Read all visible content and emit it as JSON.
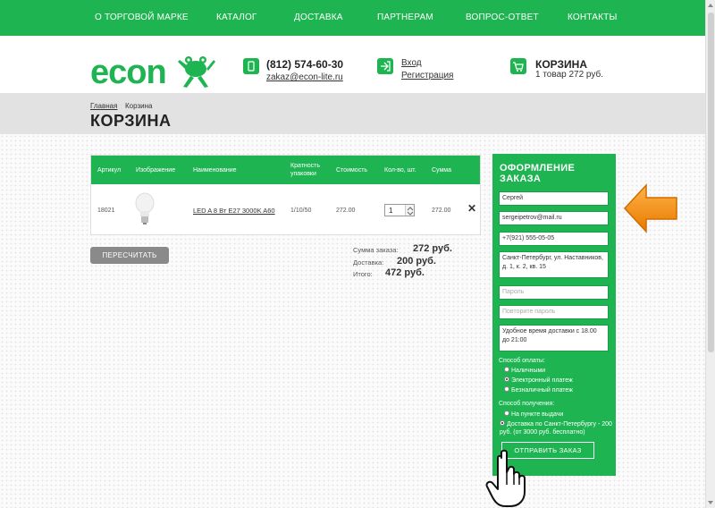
{
  "nav": {
    "items": [
      "О ТОРГОВОЙ МАРКЕ",
      "КАТАЛОГ",
      "ДОСТАВКА",
      "ПАРТНЕРАМ",
      "ВОПРОС-ОТВЕТ",
      "КОНТАКТЫ"
    ]
  },
  "brand": {
    "logo_text": "econ",
    "accent": "#1eb451"
  },
  "header": {
    "phone": "(812) 574-60-30",
    "email": "zakaz@econ-lite.ru",
    "login": "Вход",
    "register": "Регистрация",
    "cart_title": "КОРЗИНА",
    "cart_summary": "1 товар 272 руб."
  },
  "breadcrumb": {
    "home": "Главная",
    "current": "Корзина"
  },
  "page_title": "КОРЗИНА",
  "cart_table": {
    "headers": [
      "Артикул",
      "Изображение",
      "Наименование",
      "Кратность упаковки",
      "Стоимость",
      "Кол-во, шт.",
      "Сумма"
    ],
    "rows": [
      {
        "article": "18021",
        "image": "bulb-image",
        "name": "LED A 8 Вт E27 3000K A60",
        "pack": "1/10/50",
        "price": "272.00",
        "qty": "1",
        "sum": "272.00"
      }
    ]
  },
  "recalc_label": "ПЕРЕСЧИТАТЬ",
  "summary": {
    "subtotal_label": "Сумма заказа:",
    "subtotal": "272 руб.",
    "delivery_label": "Доставка:",
    "delivery": "200 руб.",
    "total_label": "Итого:",
    "total": "472 руб."
  },
  "order_form": {
    "title": "ОФОРМЛЕНИЕ ЗАКАЗА",
    "name": "Сергей",
    "email": "sergeipetrov@mail.ru",
    "phone": "+7(921) 555-05-05",
    "address": "Санкт-Петербург, ул. Наставников, д. 1, к. 2, кв. 15",
    "password_placeholder": "Пароль",
    "password_repeat_placeholder": "Повторите пароль",
    "comment": "Удобное время доставки с 18.00 до 21:00",
    "payment_label": "Способ оплаты:",
    "payment_options": [
      "Наличными",
      "Электронный платеж",
      "Безналичный платеж"
    ],
    "payment_selected": "Электронный платеж",
    "delivery_label": "Способ получения:",
    "delivery_options": [
      "На пункте выдачи",
      "Доставка по Санкт-Петербургу - 200 руб. (от 3000 руб. бесплатно)"
    ],
    "delivery_selected": "Доставка по Санкт-Петербургу - 200 руб. (от 3000 руб. бесплатно)",
    "submit": "ОТПРАВИТЬ ЗАКАЗ"
  }
}
